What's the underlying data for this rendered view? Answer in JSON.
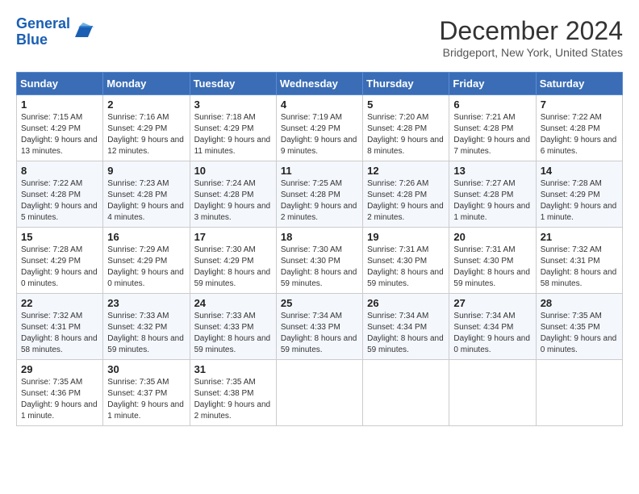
{
  "header": {
    "logo_line1": "General",
    "logo_line2": "Blue",
    "main_title": "December 2024",
    "subtitle": "Bridgeport, New York, United States"
  },
  "weekdays": [
    "Sunday",
    "Monday",
    "Tuesday",
    "Wednesday",
    "Thursday",
    "Friday",
    "Saturday"
  ],
  "weeks": [
    [
      {
        "day": "1",
        "sunrise": "7:15 AM",
        "sunset": "4:29 PM",
        "daylight": "9 hours and 13 minutes."
      },
      {
        "day": "2",
        "sunrise": "7:16 AM",
        "sunset": "4:29 PM",
        "daylight": "9 hours and 12 minutes."
      },
      {
        "day": "3",
        "sunrise": "7:18 AM",
        "sunset": "4:29 PM",
        "daylight": "9 hours and 11 minutes."
      },
      {
        "day": "4",
        "sunrise": "7:19 AM",
        "sunset": "4:29 PM",
        "daylight": "9 hours and 9 minutes."
      },
      {
        "day": "5",
        "sunrise": "7:20 AM",
        "sunset": "4:28 PM",
        "daylight": "9 hours and 8 minutes."
      },
      {
        "day": "6",
        "sunrise": "7:21 AM",
        "sunset": "4:28 PM",
        "daylight": "9 hours and 7 minutes."
      },
      {
        "day": "7",
        "sunrise": "7:22 AM",
        "sunset": "4:28 PM",
        "daylight": "9 hours and 6 minutes."
      }
    ],
    [
      {
        "day": "8",
        "sunrise": "7:22 AM",
        "sunset": "4:28 PM",
        "daylight": "9 hours and 5 minutes."
      },
      {
        "day": "9",
        "sunrise": "7:23 AM",
        "sunset": "4:28 PM",
        "daylight": "9 hours and 4 minutes."
      },
      {
        "day": "10",
        "sunrise": "7:24 AM",
        "sunset": "4:28 PM",
        "daylight": "9 hours and 3 minutes."
      },
      {
        "day": "11",
        "sunrise": "7:25 AM",
        "sunset": "4:28 PM",
        "daylight": "9 hours and 2 minutes."
      },
      {
        "day": "12",
        "sunrise": "7:26 AM",
        "sunset": "4:28 PM",
        "daylight": "9 hours and 2 minutes."
      },
      {
        "day": "13",
        "sunrise": "7:27 AM",
        "sunset": "4:28 PM",
        "daylight": "9 hours and 1 minute."
      },
      {
        "day": "14",
        "sunrise": "7:28 AM",
        "sunset": "4:29 PM",
        "daylight": "9 hours and 1 minute."
      }
    ],
    [
      {
        "day": "15",
        "sunrise": "7:28 AM",
        "sunset": "4:29 PM",
        "daylight": "9 hours and 0 minutes."
      },
      {
        "day": "16",
        "sunrise": "7:29 AM",
        "sunset": "4:29 PM",
        "daylight": "9 hours and 0 minutes."
      },
      {
        "day": "17",
        "sunrise": "7:30 AM",
        "sunset": "4:29 PM",
        "daylight": "8 hours and 59 minutes."
      },
      {
        "day": "18",
        "sunrise": "7:30 AM",
        "sunset": "4:30 PM",
        "daylight": "8 hours and 59 minutes."
      },
      {
        "day": "19",
        "sunrise": "7:31 AM",
        "sunset": "4:30 PM",
        "daylight": "8 hours and 59 minutes."
      },
      {
        "day": "20",
        "sunrise": "7:31 AM",
        "sunset": "4:30 PM",
        "daylight": "8 hours and 59 minutes."
      },
      {
        "day": "21",
        "sunrise": "7:32 AM",
        "sunset": "4:31 PM",
        "daylight": "8 hours and 58 minutes."
      }
    ],
    [
      {
        "day": "22",
        "sunrise": "7:32 AM",
        "sunset": "4:31 PM",
        "daylight": "8 hours and 58 minutes."
      },
      {
        "day": "23",
        "sunrise": "7:33 AM",
        "sunset": "4:32 PM",
        "daylight": "8 hours and 59 minutes."
      },
      {
        "day": "24",
        "sunrise": "7:33 AM",
        "sunset": "4:33 PM",
        "daylight": "8 hours and 59 minutes."
      },
      {
        "day": "25",
        "sunrise": "7:34 AM",
        "sunset": "4:33 PM",
        "daylight": "8 hours and 59 minutes."
      },
      {
        "day": "26",
        "sunrise": "7:34 AM",
        "sunset": "4:34 PM",
        "daylight": "8 hours and 59 minutes."
      },
      {
        "day": "27",
        "sunrise": "7:34 AM",
        "sunset": "4:34 PM",
        "daylight": "9 hours and 0 minutes."
      },
      {
        "day": "28",
        "sunrise": "7:35 AM",
        "sunset": "4:35 PM",
        "daylight": "9 hours and 0 minutes."
      }
    ],
    [
      {
        "day": "29",
        "sunrise": "7:35 AM",
        "sunset": "4:36 PM",
        "daylight": "9 hours and 1 minute."
      },
      {
        "day": "30",
        "sunrise": "7:35 AM",
        "sunset": "4:37 PM",
        "daylight": "9 hours and 1 minute."
      },
      {
        "day": "31",
        "sunrise": "7:35 AM",
        "sunset": "4:38 PM",
        "daylight": "9 hours and 2 minutes."
      },
      null,
      null,
      null,
      null
    ]
  ],
  "labels": {
    "sunrise": "Sunrise:",
    "sunset": "Sunset:",
    "daylight": "Daylight:"
  }
}
